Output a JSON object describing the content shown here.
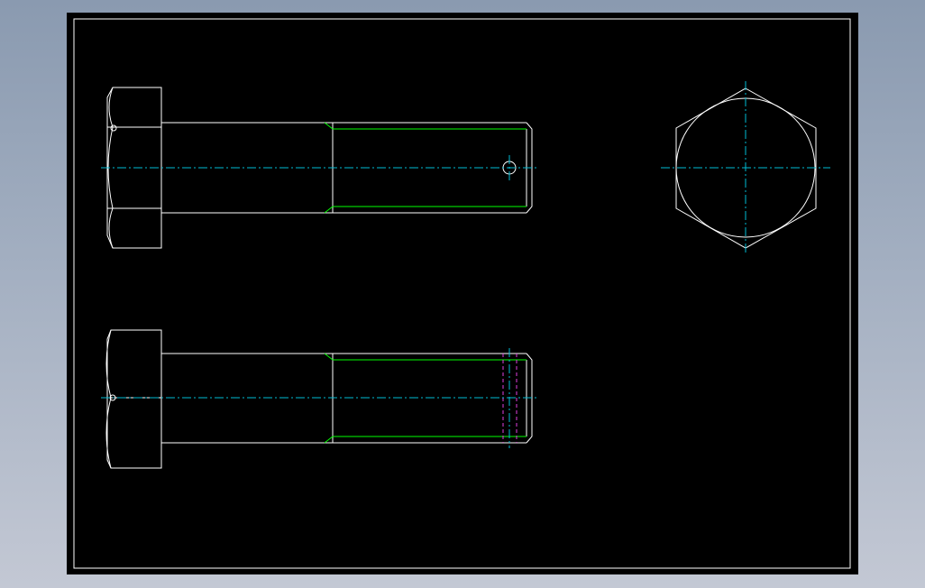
{
  "drawing": {
    "subject": "hex-bolt",
    "views": [
      "side-view",
      "side-view-section",
      "end-view"
    ],
    "colors": {
      "background": "#000000",
      "outline": "#ffffff",
      "thread": "#00ff00",
      "centerline": "#00bcd4",
      "hidden": "#e040e0"
    }
  }
}
